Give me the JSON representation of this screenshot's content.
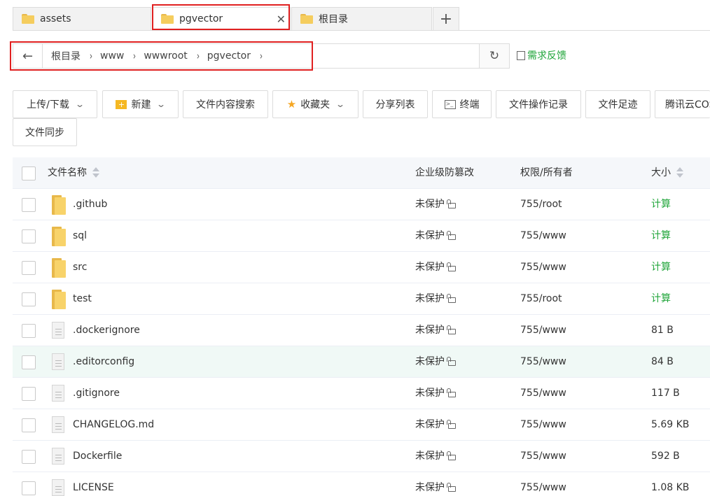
{
  "tabs": [
    {
      "label": "assets"
    },
    {
      "label": "pgvector",
      "active": true,
      "close": "✕"
    },
    {
      "label": "根目录"
    }
  ],
  "tab_add": "+",
  "path": {
    "back": "←",
    "crumbs": [
      "根目录",
      "www",
      "wwwroot",
      "pgvector"
    ],
    "separator": "›",
    "refresh": "↻"
  },
  "feedback_label": "需求反馈",
  "toolbar": {
    "upload": "上传/下载",
    "new": "新建",
    "content_search": "文件内容搜索",
    "favorites": "收藏夹",
    "share_list": "分享列表",
    "terminal": "终端",
    "op_log": "文件操作记录",
    "footprint": "文件足迹",
    "tencent": "腾讯云COS",
    "sync": "文件同步"
  },
  "table": {
    "headers": {
      "name": "文件名称",
      "tamper": "企业级防篡改",
      "perm": "权限/所有者",
      "size": "大小"
    },
    "rows": [
      {
        "name": ".github",
        "type": "folder",
        "tamper": "未保护",
        "perm": "755/root",
        "size": "计算"
      },
      {
        "name": "sql",
        "type": "folder",
        "tamper": "未保护",
        "perm": "755/www",
        "size": "计算"
      },
      {
        "name": "src",
        "type": "folder",
        "tamper": "未保护",
        "perm": "755/www",
        "size": "计算"
      },
      {
        "name": "test",
        "type": "folder",
        "tamper": "未保护",
        "perm": "755/root",
        "size": "计算"
      },
      {
        "name": ".dockerignore",
        "type": "file",
        "tamper": "未保护",
        "perm": "755/www",
        "size": "81 B"
      },
      {
        "name": ".editorconfig",
        "type": "file",
        "tamper": "未保护",
        "perm": "755/www",
        "size": "84 B"
      },
      {
        "name": ".gitignore",
        "type": "file",
        "tamper": "未保护",
        "perm": "755/www",
        "size": "117 B"
      },
      {
        "name": "CHANGELOG.md",
        "type": "file",
        "tamper": "未保护",
        "perm": "755/www",
        "size": "5.69 KB"
      },
      {
        "name": "Dockerfile",
        "type": "file",
        "tamper": "未保护",
        "perm": "755/www",
        "size": "592 B"
      },
      {
        "name": "LICENSE",
        "type": "file",
        "tamper": "未保护",
        "perm": "755/www",
        "size": "1.08 KB"
      }
    ]
  },
  "colors": {
    "accent": "#20a53a",
    "highlight": "#e02020",
    "hover_row": "#f0f9f6",
    "folder": "#f5cd5e"
  }
}
